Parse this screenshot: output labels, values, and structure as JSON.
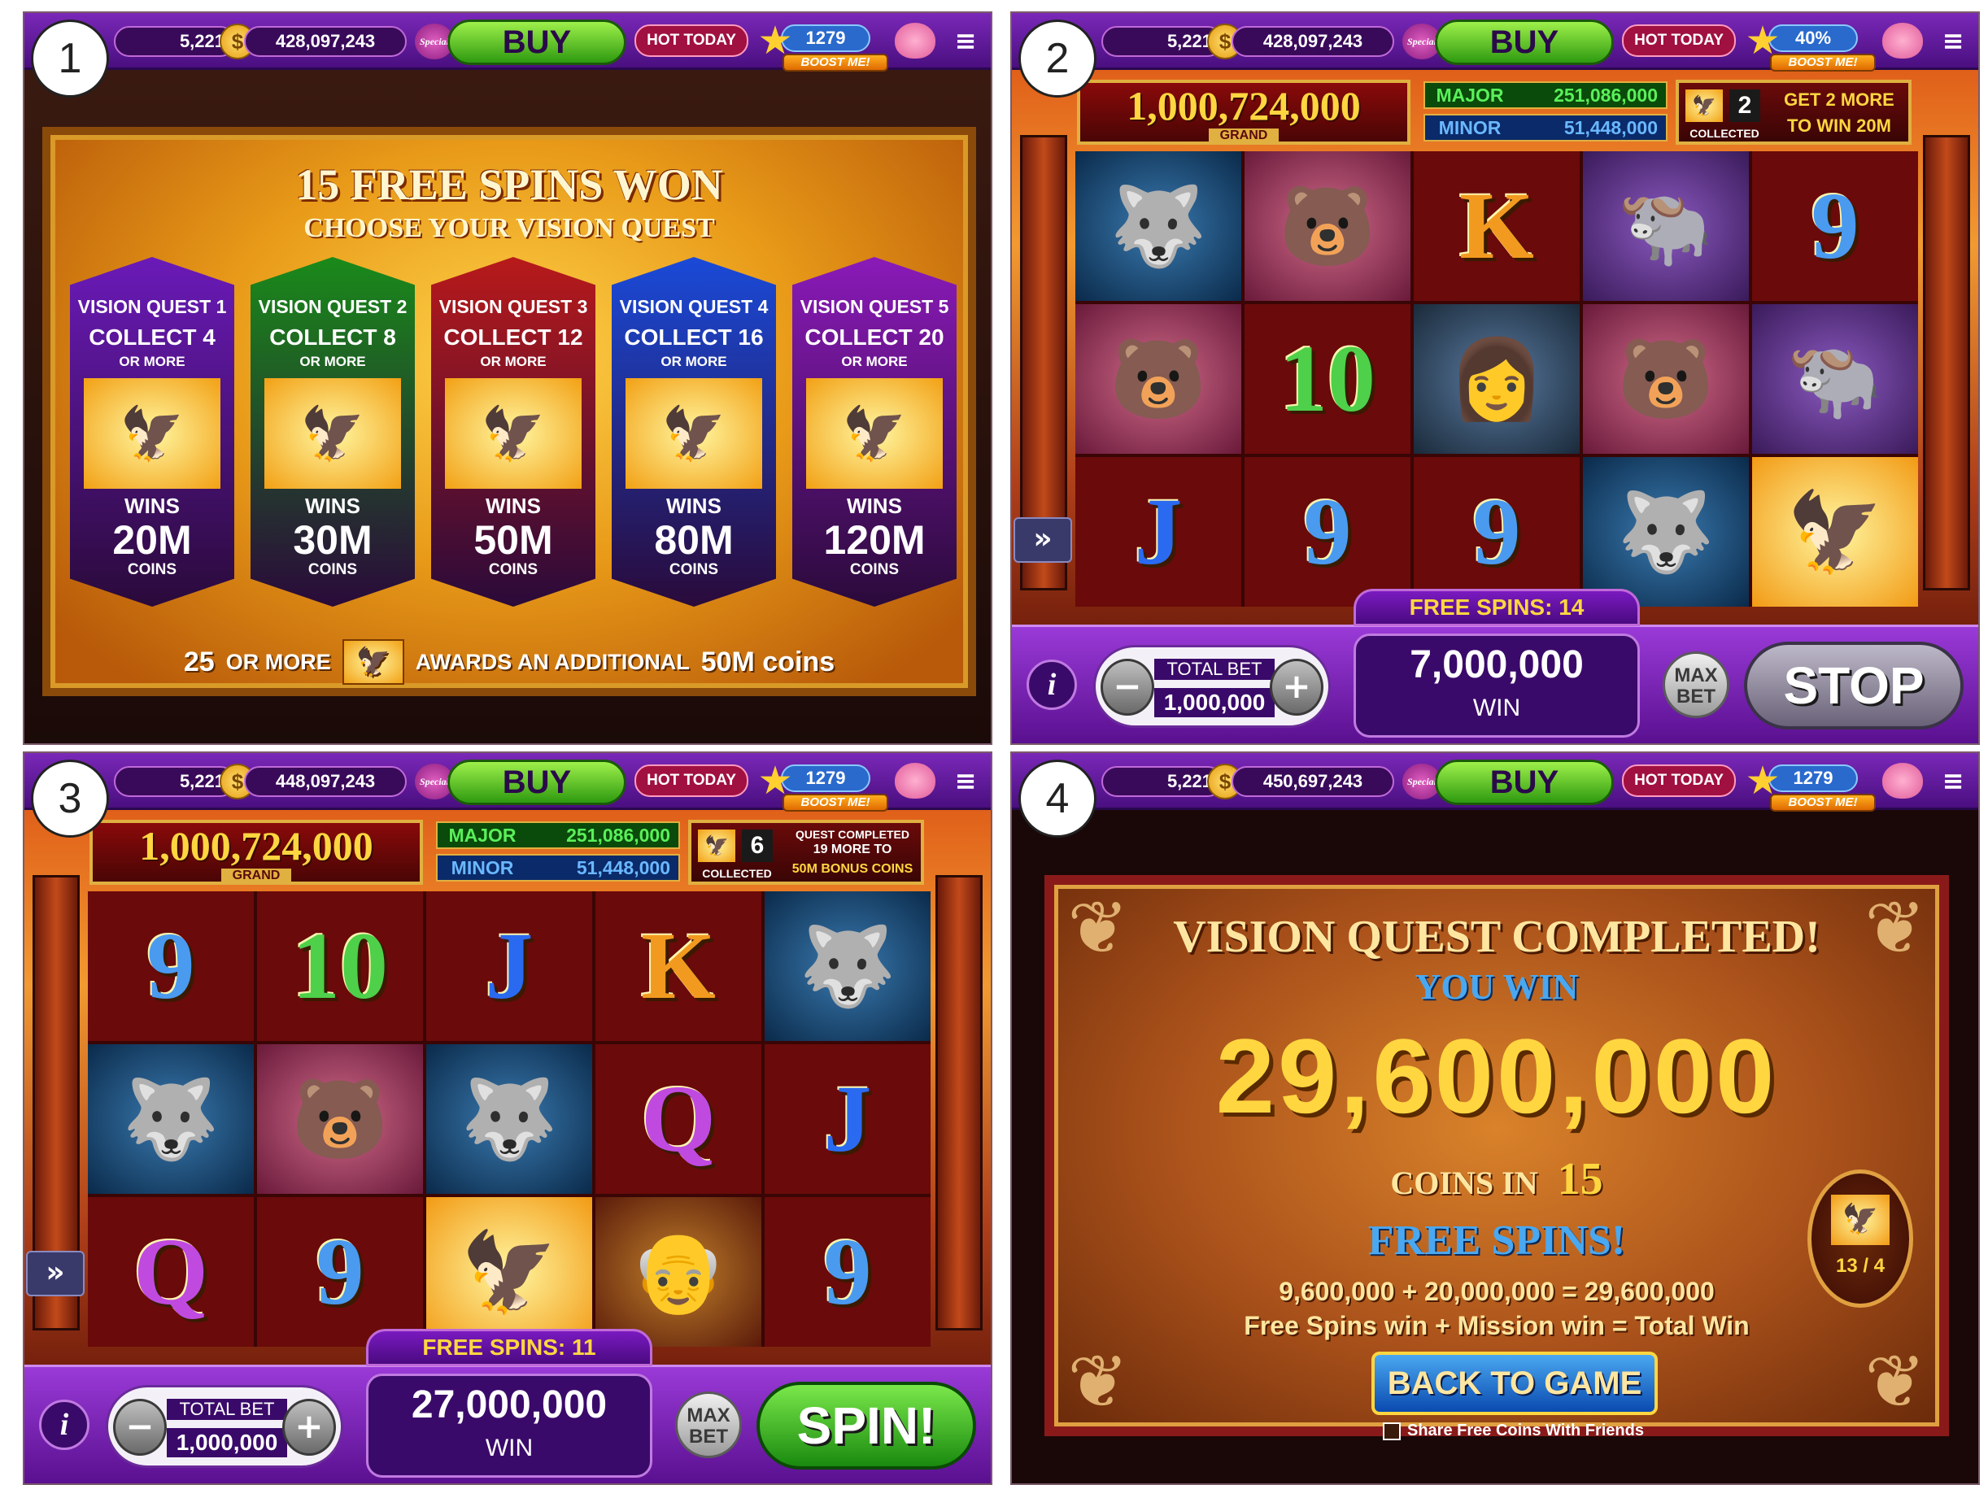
{
  "panels": [
    {
      "label": "1",
      "level": "5,221",
      "balance": "428,097,243",
      "level_num": "1279"
    },
    {
      "label": "2",
      "level": "5,221",
      "balance": "428,097,243",
      "level_num": "40%"
    },
    {
      "label": "3",
      "level": "5,221",
      "balance": "448,097,243",
      "level_num": "1279"
    },
    {
      "label": "4",
      "level": "5,221",
      "balance": "450,697,243",
      "level_num": "1279"
    }
  ],
  "topbar": {
    "coin_icon": "$",
    "special_label": "Special",
    "buy_label": "BUY",
    "hot_label": "HOT TODAY",
    "boost_label": "BOOST ME!",
    "menu_icon": "≡",
    "star_icon": "★"
  },
  "panel1": {
    "title": "15 FREE SPINS WON",
    "subtitle": "CHOOSE YOUR VISION QUEST",
    "quests": [
      {
        "title": "VISION QUEST 1",
        "collect": "COLLECT 4",
        "more": "OR MORE",
        "wins": "WINS",
        "value": "20M",
        "coins": "COINS",
        "color": "#6a1ab8"
      },
      {
        "title": "VISION QUEST 2",
        "collect": "COLLECT 8",
        "more": "OR MORE",
        "wins": "WINS",
        "value": "30M",
        "coins": "COINS",
        "color": "#1a8a1a"
      },
      {
        "title": "VISION QUEST 3",
        "collect": "COLLECT 12",
        "more": "OR MORE",
        "wins": "WINS",
        "value": "50M",
        "coins": "COINS",
        "color": "#b81a1a"
      },
      {
        "title": "VISION QUEST 4",
        "collect": "COLLECT 16",
        "more": "OR MORE",
        "wins": "WINS",
        "value": "80M",
        "coins": "COINS",
        "color": "#1a4ad8"
      },
      {
        "title": "VISION QUEST 5",
        "collect": "COLLECT 20",
        "more": "OR MORE",
        "wins": "WINS",
        "value": "120M",
        "coins": "COINS",
        "color": "#8a1ab8"
      }
    ],
    "footer_count": "25",
    "footer_more": "OR MORE",
    "footer_awards": "AWARDS AN ADDITIONAL",
    "footer_value": "50M coins",
    "eagle_icon": "🦅"
  },
  "jackpots": {
    "grand_value": "1,000,724,000",
    "grand_label": "GRAND",
    "major_label": "MAJOR",
    "major_value": "251,086,000",
    "minor_label": "MINOR",
    "minor_value": "51,448,000"
  },
  "panel2": {
    "collected": "2",
    "collected_label": "COLLECTED",
    "msg1": "GET 2 MORE",
    "msg2": "TO WIN 20M",
    "free_spins": "FREE SPINS: 14",
    "bet_label": "TOTAL BET",
    "bet_value": "1,000,000",
    "win_value": "7,000,000",
    "win_label": "WIN",
    "maxbet_label": "MAX BET",
    "action_label": "STOP",
    "reels": [
      {
        "type": "wolf",
        "glyph": "🐺"
      },
      {
        "type": "bear",
        "glyph": "🐻"
      },
      {
        "type": "card-K",
        "glyph": "K"
      },
      {
        "type": "buffalo",
        "glyph": "🐃"
      },
      {
        "type": "card-9",
        "glyph": "9"
      },
      {
        "type": "bear",
        "glyph": "🐻"
      },
      {
        "type": "card-10",
        "glyph": "10"
      },
      {
        "type": "woman",
        "glyph": "👩"
      },
      {
        "type": "bear",
        "glyph": "🐻"
      },
      {
        "type": "buffalo",
        "glyph": "🐃"
      },
      {
        "type": "card-J",
        "glyph": "J"
      },
      {
        "type": "card-9",
        "glyph": "9"
      },
      {
        "type": "card-9",
        "glyph": "9"
      },
      {
        "type": "wolf",
        "glyph": "🐺"
      },
      {
        "type": "eagle",
        "glyph": "🦅"
      }
    ]
  },
  "panel3": {
    "collected": "6",
    "collected_label": "COLLECTED",
    "msg1": "QUEST COMPLETED",
    "msg2": "19 MORE TO",
    "msg3": "50M BONUS COINS",
    "free_spins": "FREE SPINS: 11",
    "bet_label": "TOTAL BET",
    "bet_value": "1,000,000",
    "win_value": "27,000,000",
    "win_label": "WIN",
    "maxbet_label": "MAX BET",
    "action_label": "SPIN!",
    "reels": [
      {
        "type": "card-9",
        "glyph": "9"
      },
      {
        "type": "card-10",
        "glyph": "10"
      },
      {
        "type": "card-J",
        "glyph": "J"
      },
      {
        "type": "card-K",
        "glyph": "K"
      },
      {
        "type": "wolf",
        "glyph": "🐺"
      },
      {
        "type": "wolf",
        "glyph": "🐺"
      },
      {
        "type": "bear",
        "glyph": "🐻"
      },
      {
        "type": "wolf",
        "glyph": "🐺"
      },
      {
        "type": "card-Q",
        "glyph": "Q"
      },
      {
        "type": "card-J",
        "glyph": "J"
      },
      {
        "type": "card-Q",
        "glyph": "Q"
      },
      {
        "type": "card-9",
        "glyph": "9"
      },
      {
        "type": "eagle",
        "glyph": "🦅"
      },
      {
        "type": "chief",
        "glyph": "👴"
      },
      {
        "type": "card-9",
        "glyph": "9"
      }
    ]
  },
  "panel4": {
    "title": "VISION QUEST COMPLETED!",
    "you_win": "YOU WIN",
    "amount": "29,600,000",
    "coins_in": "COINS IN",
    "spins_count": "15",
    "free_spins": "FREE SPINS!",
    "equation": "9,600,000 + 20,000,000 = 29,600,000",
    "equation_labels": "Free Spins win + Mission win = Total Win",
    "back_button": "BACK TO GAME",
    "share_label": "Share Free Coins With Friends",
    "medal_text": "13 / 4",
    "feather_icon": "❦"
  },
  "arrows_icon": "»",
  "info_icon": "i",
  "minus_icon": "−",
  "plus_icon": "+"
}
